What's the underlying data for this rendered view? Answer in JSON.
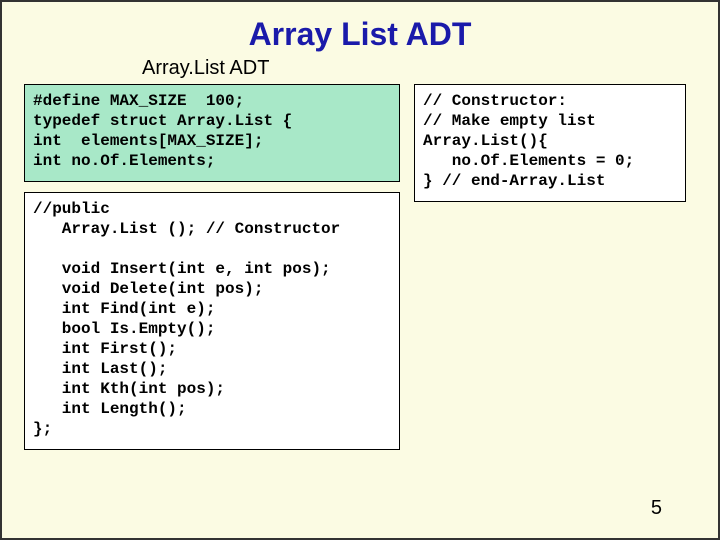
{
  "title": "Array List ADT",
  "subtitle": "Array.List ADT",
  "code": {
    "defs": "#define MAX_SIZE  100;\ntypedef struct Array.List {\nint  elements[MAX_SIZE];\nint no.Of.Elements;\n",
    "constructor": "// Constructor:\n// Make empty list\nArray.List(){\n   no.Of.Elements = 0;\n} // end-Array.List",
    "api": "//public\n   Array.List (); // Constructor\n\n   void Insert(int e, int pos);\n   void Delete(int pos);\n   int Find(int e);\n   bool Is.Empty();\n   int First();\n   int Last();\n   int Kth(int pos);\n   int Length();\n};"
  },
  "page_number": "5"
}
